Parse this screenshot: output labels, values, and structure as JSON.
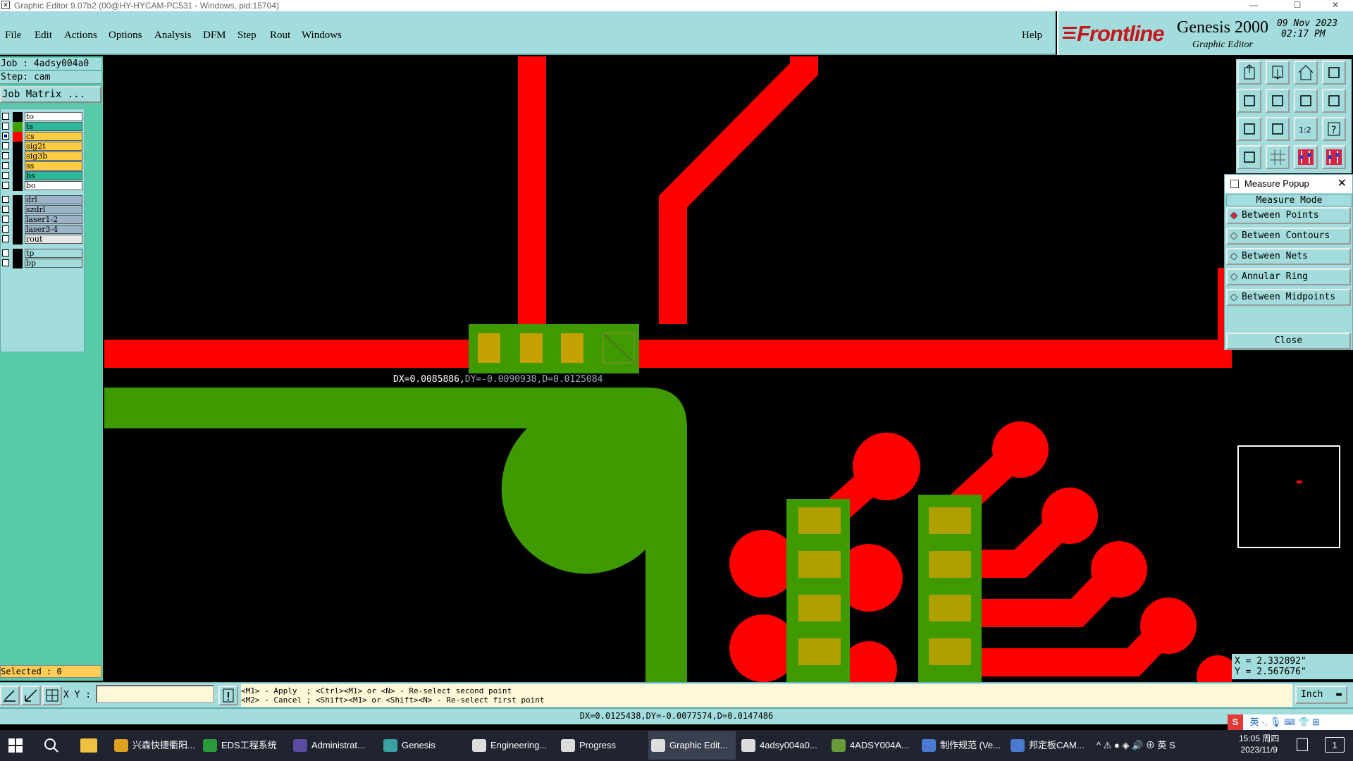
{
  "window": {
    "title": "Graphic Editor 9.07b2 (00@HY-HYCAM-PC531 - Windows, pid:15704)",
    "minimize": "—",
    "maximize": "☐",
    "close": "✕"
  },
  "menu": {
    "file": "File",
    "edit": "Edit",
    "actions": "Actions",
    "options": "Options",
    "analysis": "Analysis",
    "dfm": "DFM",
    "step": "Step",
    "rout": "Rout",
    "windows": "Windows",
    "help": "Help"
  },
  "brand": {
    "logo": "Frontline",
    "product": "Genesis 2000",
    "subtitle": "Graphic Editor",
    "date_line1": "09 Nov 2023",
    "date_line2": "02:17 PM"
  },
  "job": {
    "job_label": "Job : 4adsy004a0",
    "step_label": "Step: cam",
    "matrix_button": "Job Matrix ..."
  },
  "layers": [
    {
      "name": "to",
      "color": "#ffffff",
      "swatch": "#000000",
      "selected": false
    },
    {
      "name": "ts",
      "color": "#2eb89a",
      "swatch": "#3fa000",
      "selected": false
    },
    {
      "name": "cs",
      "color": "#ffcc44",
      "swatch": "#ff0000",
      "selected": true
    },
    {
      "name": "sig2t",
      "color": "#ffcc44",
      "swatch": "#000000",
      "selected": false
    },
    {
      "name": "sig3b",
      "color": "#ffcc44",
      "swatch": "#000000",
      "selected": false
    },
    {
      "name": "ss",
      "color": "#ffcc44",
      "swatch": "#000000",
      "selected": false
    },
    {
      "name": "bs",
      "color": "#2eb89a",
      "swatch": "#000000",
      "selected": false
    },
    {
      "name": "bo",
      "color": "#ffffff",
      "swatch": "#000000",
      "selected": false
    },
    {
      "name": "drl",
      "color": "#9cb4c8",
      "swatch": "#000000",
      "selected": false
    },
    {
      "name": "szdrl",
      "color": "#9cb4c8",
      "swatch": "#000000",
      "selected": false
    },
    {
      "name": "laser1-2",
      "color": "#9cb4c8",
      "swatch": "#000000",
      "selected": false
    },
    {
      "name": "laser3-4",
      "color": "#9cb4c8",
      "swatch": "#000000",
      "selected": false
    },
    {
      "name": "rout",
      "color": "#e8e8e8",
      "swatch": "#000000",
      "selected": false
    },
    {
      "name": "tp",
      "color": "#a3dcdc",
      "swatch": "#000000",
      "selected": false
    },
    {
      "name": "bp",
      "color": "#a3dcdc",
      "swatch": "#000000",
      "selected": false
    }
  ],
  "selected_count": "Selected : 0",
  "canvas": {
    "measure_dx": "DX=0.0085886,",
    "measure_rest": "DY=-0.0090938,D=0.0125084"
  },
  "popup": {
    "title": "Measure Popup",
    "close_x": "✕",
    "mode_header": "Measure Mode",
    "options": [
      "Between Points",
      "Between Contours",
      "Between Nets",
      "Annular Ring",
      "Between Midpoints"
    ],
    "close_button": "Close"
  },
  "cursor": {
    "x": "X = 2.332892\"",
    "y": "Y = 2.567676\""
  },
  "command": {
    "xy_label": "X Y :",
    "input_value": "",
    "hint_line1": "<M1> - Apply  ; <Ctrl><M1> or <N> - Re-select second point",
    "hint_line2": "<M2> - Cancel ; <Shift><M1> or <Shift><N> - Re-select first point",
    "unit": "Inch"
  },
  "status": "DX=0.0125438,DY=-0.0077574,D=0.0147486",
  "ime": "英 ·, 🎙 ⌨ 👕 ⊞",
  "taskbar": {
    "items": [
      {
        "label": "兴森快捷衢阳...",
        "color": "#e0a020",
        "active": false
      },
      {
        "label": "EDS工程系统",
        "color": "#2a9a3a",
        "active": false
      },
      {
        "label": "Administrat...",
        "color": "#5a4aa0",
        "active": false
      },
      {
        "label": "Genesis",
        "color": "#3aa0a0",
        "active": false
      },
      {
        "label": "Engineering...",
        "color": "#dddddd",
        "active": false
      },
      {
        "label": "Progress",
        "color": "#dddddd",
        "active": false
      },
      {
        "label": "Graphic Edit...",
        "color": "#dddddd",
        "active": true
      },
      {
        "label": "4adsy004a0...",
        "color": "#dddddd",
        "active": false
      },
      {
        "label": "4ADSY004A...",
        "color": "#6a9a3a",
        "active": false
      },
      {
        "label": "制作规范 (Ve...",
        "color": "#4a7ad0",
        "active": false
      },
      {
        "label": "邦定板CAM...",
        "color": "#4a7ad0",
        "active": false
      }
    ],
    "tray": "^  ⚠ ● ◈ 🔊 ⊕ 英 S",
    "time": "15:05 周四",
    "date": "2023/11/9",
    "notifications": "1"
  }
}
